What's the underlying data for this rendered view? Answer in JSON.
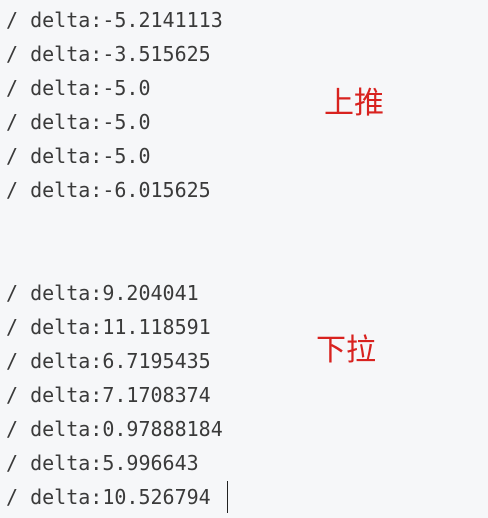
{
  "log_lines": [
    "/ delta:-5.2141113",
    "/ delta:-3.515625",
    "/ delta:-5.0",
    "/ delta:-5.0",
    "/ delta:-5.0",
    "/ delta:-6.015625",
    "/ delta:9.204041",
    "/ delta:11.118591",
    "/ delta:6.7195435",
    "/ delta:7.1708374",
    "/ delta:0.97888184",
    "/ delta:5.996643",
    "/ delta:10.526794"
  ],
  "annotations": {
    "push_up": "上推",
    "pull_down": "下拉"
  },
  "colors": {
    "background": "#f6f7f9",
    "text": "#3a3a3a",
    "annotation": "#d8221f"
  }
}
